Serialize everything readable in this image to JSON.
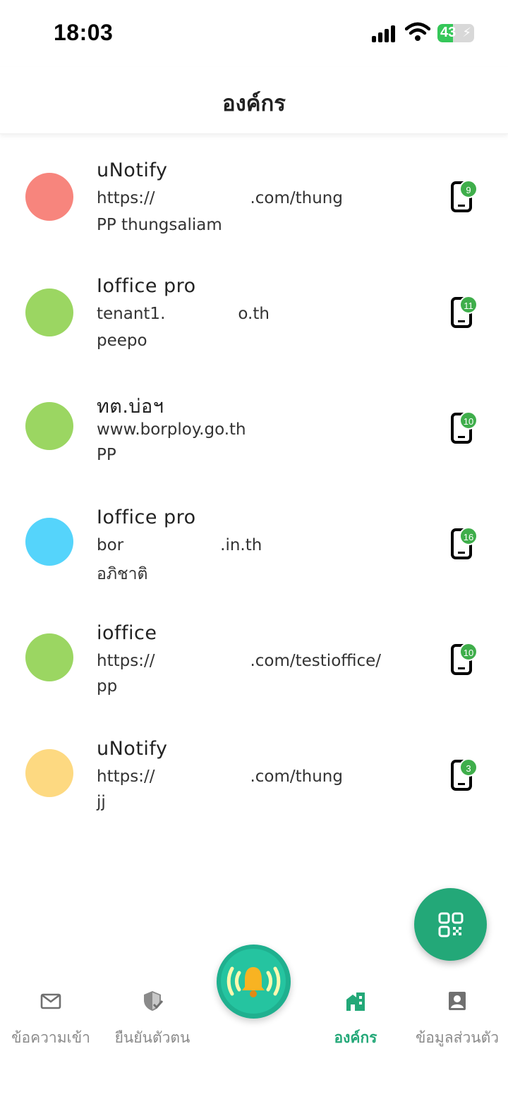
{
  "status_bar": {
    "time": "18:03",
    "battery_level": "43",
    "battery_fraction": 0.43,
    "icons": [
      "signal-icon",
      "wifi-icon",
      "battery-charging-icon"
    ]
  },
  "header": {
    "title": "องค์กร"
  },
  "organizations": [
    {
      "name": "uNotify",
      "url_start": "https://",
      "url_end": ".com/thung",
      "user": "PP thungsaliam",
      "avatar_color": "#f7857d",
      "device_count": "9"
    },
    {
      "name": "Ioffice pro",
      "url_start": "tenant1.",
      "url_end": "o.th",
      "user": "peepo",
      "avatar_color": "#9bd662",
      "device_count": "11"
    },
    {
      "name": "ทต.บ่อฯ",
      "url_start": "www.borploy.go.th",
      "url_end": "",
      "user": "PP",
      "avatar_color": "#9bd662",
      "device_count": "10"
    },
    {
      "name": "Ioffice pro",
      "url_start": "bor",
      "url_end": ".in.th",
      "user": "อภิชาติ",
      "avatar_color": "#55d4fb",
      "device_count": "16"
    },
    {
      "name": "ioffice",
      "url_start": "https://",
      "url_end": ".com/testioffice/",
      "user": "pp",
      "avatar_color": "#9bd662",
      "device_count": "10"
    },
    {
      "name": "uNotify",
      "url_start": "https://",
      "url_end": ".com/thung",
      "user": "jj",
      "avatar_color": "#fdd981",
      "device_count": "3"
    }
  ],
  "fab": {
    "icon": "qr-code-icon"
  },
  "bottom_nav": {
    "items": [
      {
        "label": "ข้อความเข้า",
        "icon": "mail-icon",
        "active": false
      },
      {
        "label": "ยืนยันตัวตน",
        "icon": "shield-check-icon",
        "active": false
      },
      {
        "label": "",
        "icon": "bell-icon",
        "active": false
      },
      {
        "label": "องค์กร",
        "icon": "building-icon",
        "active": true
      },
      {
        "label": "ข้อมูลส่วนตัว",
        "icon": "profile-icon",
        "active": false
      }
    ]
  },
  "colors": {
    "accent": "#23a878",
    "badge": "#3fae4b",
    "inactive": "#8a8a8a"
  }
}
